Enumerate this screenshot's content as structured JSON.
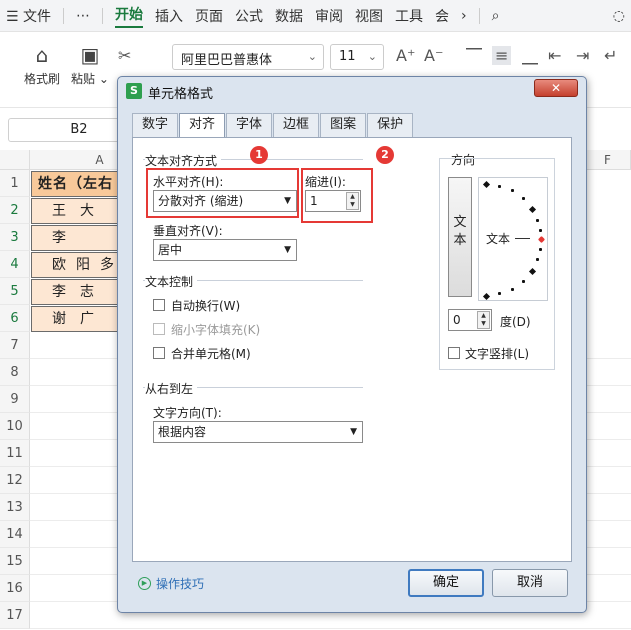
{
  "menubar": {
    "items": [
      {
        "label": "☰ 文件"
      },
      {
        "label": "⋯"
      },
      {
        "label": "开始",
        "active": true
      },
      {
        "label": "插入"
      },
      {
        "label": "页面"
      },
      {
        "label": "公式"
      },
      {
        "label": "数据"
      },
      {
        "label": "审阅"
      },
      {
        "label": "视图"
      },
      {
        "label": "工具"
      },
      {
        "label": "会"
      }
    ],
    "more_glyph": "›"
  },
  "ribbon": {
    "format_painter": "格式刷",
    "paste": "粘贴",
    "font_name": "阿里巴巴普惠体",
    "font_size": "11"
  },
  "namebox": "B2",
  "sheet": {
    "columns": [
      "A",
      "F"
    ],
    "rows": [
      "1",
      "2",
      "3",
      "4",
      "5",
      "6",
      "7",
      "8",
      "9",
      "10",
      "11",
      "12",
      "13",
      "14",
      "15",
      "16",
      "17"
    ],
    "cells": [
      "姓名（左右",
      "王大",
      "李",
      "欧阳多",
      "李志",
      "谢广"
    ]
  },
  "dialog": {
    "title": "单元格格式",
    "tabs": [
      "数字",
      "对齐",
      "字体",
      "边框",
      "图案",
      "保护"
    ],
    "active_tab": "对齐",
    "text_align_group": "文本对齐方式",
    "horizontal_label": "水平对齐(H):",
    "horizontal_value": "分散对齐 (缩进)",
    "indent_label": "缩进(I):",
    "indent_value": "1",
    "vertical_label": "垂直对齐(V):",
    "vertical_value": "居中",
    "text_control_group": "文本控制",
    "wrap_text": "自动换行(W)",
    "shrink_to_fit": "缩小字体填充(K)",
    "merge_cells": "合并单元格(M)",
    "rtl_group": "从右到左",
    "text_direction_label": "文字方向(T):",
    "text_direction_value": "根据内容",
    "orientation_group": "方向",
    "vertical_text_btn": "文本",
    "dial_text": "文本",
    "degree_value": "0",
    "degree_label": "度(D)",
    "vertical_text_check": "文字竖排(L)",
    "tips_link": "操作技巧",
    "ok": "确定",
    "cancel": "取消",
    "badge1": "1",
    "badge2": "2"
  }
}
